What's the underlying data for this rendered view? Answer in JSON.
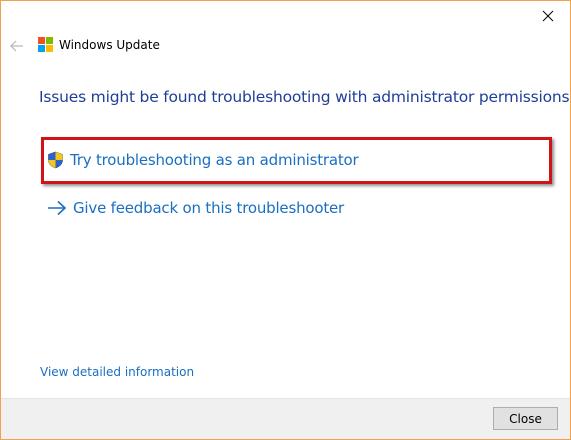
{
  "window": {
    "app_title": "Windows Update",
    "close_icon": "close-icon",
    "back_icon": "back-arrow-icon"
  },
  "main": {
    "heading": "Issues might be found troubleshooting with administrator permissions",
    "options": [
      {
        "label": "Try troubleshooting as an administrator",
        "icon": "uac-shield-icon",
        "highlighted": true
      },
      {
        "label": "Give feedback on this troubleshooter",
        "icon": "arrow-right-icon",
        "highlighted": false
      }
    ],
    "details_link": "View detailed information"
  },
  "footer": {
    "close_label": "Close"
  },
  "colors": {
    "heading": "#1f3e98",
    "link": "#1a6fc2",
    "highlight_border": "#d0121d",
    "window_border": "#f2a24a",
    "footer_bg": "#f0f0f0"
  }
}
